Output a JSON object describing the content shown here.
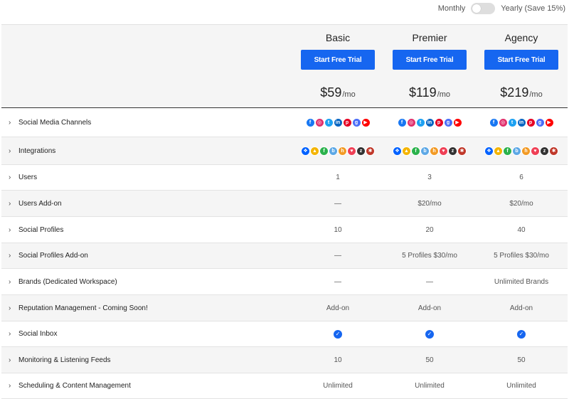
{
  "billing": {
    "monthly_label": "Monthly",
    "yearly_label": "Yearly (Save 15%)"
  },
  "plans": [
    {
      "name": "Basic",
      "cta": "Start Free Trial",
      "price": "$59",
      "unit": "/mo"
    },
    {
      "name": "Premier",
      "cta": "Start Free Trial",
      "price": "$119",
      "unit": "/mo"
    },
    {
      "name": "Agency",
      "cta": "Start Free Trial",
      "price": "$219",
      "unit": "/mo"
    }
  ],
  "social_icons": [
    {
      "name": "facebook-icon",
      "color": "#1877f2",
      "glyph": "f"
    },
    {
      "name": "instagram-icon",
      "color": "#e1306c",
      "glyph": "◎"
    },
    {
      "name": "twitter-icon",
      "color": "#1da1f2",
      "glyph": "t"
    },
    {
      "name": "linkedin-icon",
      "color": "#0a66c2",
      "glyph": "in"
    },
    {
      "name": "pinterest-icon",
      "color": "#e60023",
      "glyph": "p"
    },
    {
      "name": "google-business-icon",
      "color": "#4a6cf7",
      "glyph": "g"
    },
    {
      "name": "youtube-icon",
      "color": "#ff0000",
      "glyph": "▶"
    }
  ],
  "integration_icons": [
    {
      "name": "dropbox-icon",
      "color": "#0061ff",
      "glyph": "❖"
    },
    {
      "name": "google-drive-icon",
      "color": "#f4b400",
      "glyph": "▲"
    },
    {
      "name": "feedly-icon",
      "color": "#2bb24c",
      "glyph": "f"
    },
    {
      "name": "bitly-icon",
      "color": "#5da8e6",
      "glyph": "b"
    },
    {
      "name": "hootsuite-icon",
      "color": "#f29a25",
      "glyph": "h"
    },
    {
      "name": "pocket-icon",
      "color": "#ef4056",
      "glyph": "♥"
    },
    {
      "name": "zapier-icon",
      "color": "#333333",
      "glyph": "z"
    },
    {
      "name": "canva-icon",
      "color": "#c0392b",
      "glyph": "✱"
    }
  ],
  "rows": [
    {
      "feature": "Social Media Channels",
      "type": "social"
    },
    {
      "feature": "Integrations",
      "type": "integrations"
    },
    {
      "feature": "Users",
      "values": [
        "1",
        "3",
        "6"
      ]
    },
    {
      "feature": "Users Add-on",
      "values": [
        "—",
        "$20/mo",
        "$20/mo"
      ]
    },
    {
      "feature": "Social Profiles",
      "values": [
        "10",
        "20",
        "40"
      ]
    },
    {
      "feature": "Social Profiles Add-on",
      "values": [
        "—",
        "5 Profiles $30/mo",
        "5 Profiles $30/mo"
      ]
    },
    {
      "feature": "Brands (Dedicated Workspace)",
      "values": [
        "—",
        "—",
        "Unlimited Brands"
      ]
    },
    {
      "feature": "Reputation Management - Coming Soon!",
      "values": [
        "Add-on",
        "Add-on",
        "Add-on"
      ]
    },
    {
      "feature": "Social Inbox",
      "type": "check"
    },
    {
      "feature": "Monitoring & Listening Feeds",
      "values": [
        "10",
        "50",
        "50"
      ]
    },
    {
      "feature": "Scheduling & Content Management",
      "values": [
        "Unlimited",
        "Unlimited",
        "Unlimited"
      ]
    }
  ],
  "colors": {
    "accent": "#1666f0",
    "row_alt": "#f5f5f5"
  }
}
